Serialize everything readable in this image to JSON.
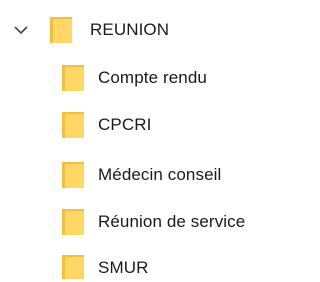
{
  "tree": {
    "root": {
      "label": "REUNION",
      "expanded": true
    },
    "children": [
      {
        "label": "Compte rendu"
      },
      {
        "label": "CPCRI"
      },
      {
        "label": "Médecin conseil"
      },
      {
        "label": "Réunion de service"
      },
      {
        "label": "SMUR"
      }
    ]
  },
  "colors": {
    "folder_body": "#ffd766",
    "folder_back": "#f2bf3a",
    "chevron": "#444444",
    "text": "#1a1a1a"
  }
}
